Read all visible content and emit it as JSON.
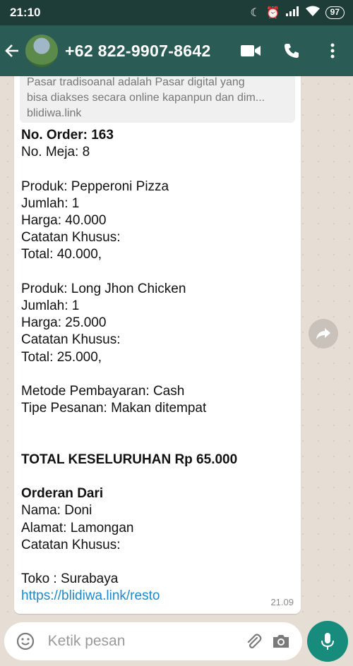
{
  "status": {
    "time": "21:10",
    "battery": "97"
  },
  "header": {
    "contact": "+62 822-9907-8642"
  },
  "link_preview": {
    "line1": "Pasar tradisoanal adalah Pasar digital yang",
    "line2": "bisa diakses secara online kapanpun dan dim...",
    "domain": "blidiwa.link"
  },
  "message": {
    "order_no": "No. Order: 163",
    "table_no": "No. Meja: 8",
    "item1": {
      "product": "Produk: Pepperoni Pizza",
      "qty": "Jumlah: 1",
      "price": "Harga: 40.000",
      "note": "Catatan Khusus:",
      "total": "Total: 40.000,"
    },
    "item2": {
      "product": "Produk: Long Jhon Chicken",
      "qty": "Jumlah: 1",
      "price": "Harga: 25.000",
      "note": "Catatan Khusus:",
      "total": "Total: 25.000,"
    },
    "payment": "Metode Pembayaran: Cash",
    "order_type": "Tipe Pesanan: Makan ditempat",
    "grand_total": "TOTAL KESELURUHAN Rp 65.000",
    "from_heading": "Orderan Dari",
    "name": "Nama: Doni",
    "address": "Alamat: Lamongan",
    "note": "Catatan Khusus:",
    "store": "Toko : Surabaya",
    "link": "https://blidiwa.link/resto",
    "time": "21.09"
  },
  "input": {
    "placeholder": "Ketik pesan"
  },
  "icons": {
    "back": "arrow-left",
    "video": "video-camera",
    "call": "phone",
    "menu": "more-vertical",
    "forward": "share-arrow",
    "emoji": "smiley",
    "attach": "paperclip",
    "camera": "camera",
    "mic": "microphone"
  },
  "colors": {
    "header": "#2a5b54",
    "accent": "#178c7c",
    "link": "#1e88c9"
  }
}
